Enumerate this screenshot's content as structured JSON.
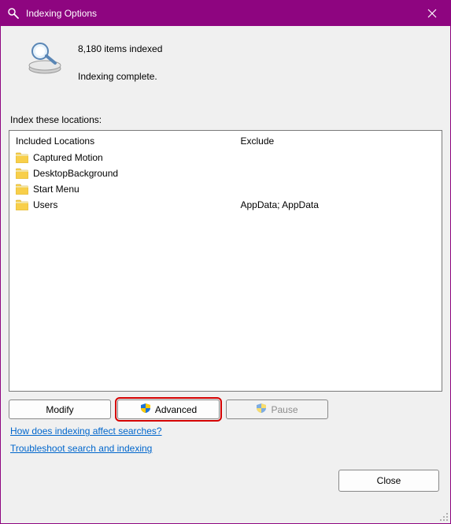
{
  "window_title": "Indexing Options",
  "status": {
    "items_indexed": "8,180 items indexed",
    "completion": "Indexing complete."
  },
  "section_label": "Index these locations:",
  "table": {
    "header_included": "Included Locations",
    "header_exclude": "Exclude",
    "rows": [
      {
        "name": "Captured Motion",
        "exclude": ""
      },
      {
        "name": "DesktopBackground",
        "exclude": ""
      },
      {
        "name": "Start Menu",
        "exclude": ""
      },
      {
        "name": "Users",
        "exclude": "AppData; AppData"
      }
    ]
  },
  "buttons": {
    "modify": "Modify",
    "advanced": "Advanced",
    "pause": "Pause",
    "close": "Close"
  },
  "links": {
    "how": "How does indexing affect searches?",
    "troubleshoot": "Troubleshoot search and indexing"
  }
}
